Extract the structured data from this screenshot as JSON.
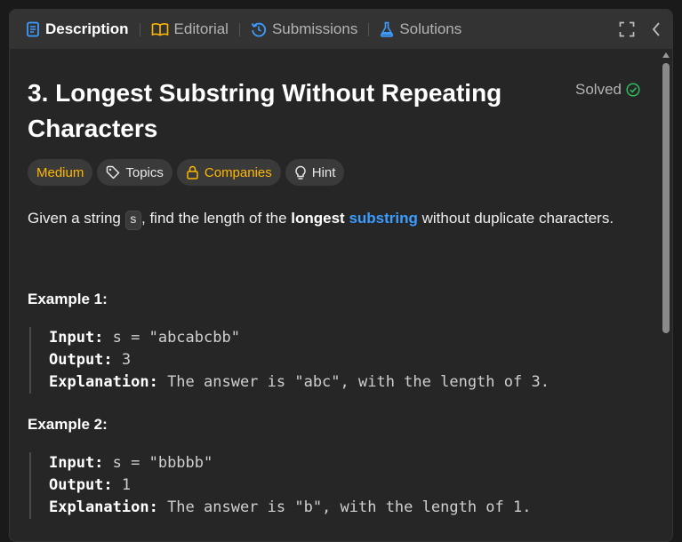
{
  "tabs": [
    {
      "label": "Description",
      "icon": "document-icon",
      "active": true,
      "color": "#3c9cff"
    },
    {
      "label": "Editorial",
      "icon": "book-icon",
      "active": false,
      "color": "#ffb800"
    },
    {
      "label": "Submissions",
      "icon": "history-icon",
      "active": false,
      "color": "#3c9cff"
    },
    {
      "label": "Solutions",
      "icon": "flask-icon",
      "active": false,
      "color": "#3c9cff"
    }
  ],
  "problem": {
    "title": "3. Longest Substring Without Repeating Characters",
    "status": "Solved",
    "status_color": "#2cbb5d"
  },
  "chips": {
    "difficulty": "Medium",
    "topics": "Topics",
    "companies": "Companies",
    "hint": "Hint"
  },
  "description": {
    "part1": "Given a string ",
    "code": "s",
    "part2": ", find the length of the ",
    "bold": "longest",
    "link": "substring",
    "part3": " without duplicate characters."
  },
  "examples": [
    {
      "title": "Example 1:",
      "input_label": "Input:",
      "input": " s = \"abcabcbb\"",
      "output_label": "Output:",
      "output": " 3",
      "explanation_label": "Explanation:",
      "explanation": " The answer is \"abc\", with the length of 3."
    },
    {
      "title": "Example 2:",
      "input_label": "Input:",
      "input": " s = \"bbbbb\"",
      "output_label": "Output:",
      "output": " 1",
      "explanation_label": "Explanation:",
      "explanation": " The answer is \"b\", with the length of 1."
    }
  ]
}
